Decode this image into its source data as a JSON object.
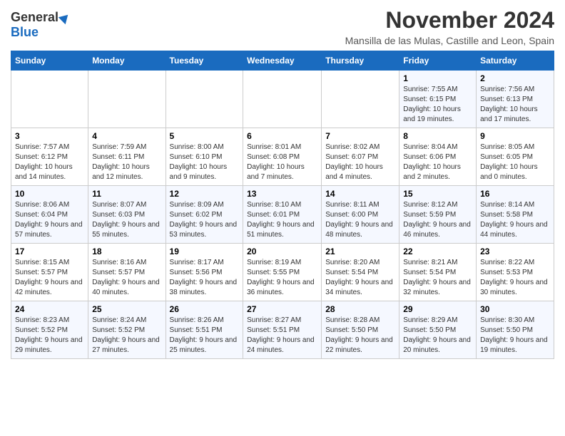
{
  "header": {
    "logo_general": "General",
    "logo_blue": "Blue",
    "month": "November 2024",
    "location": "Mansilla de las Mulas, Castille and Leon, Spain"
  },
  "weekdays": [
    "Sunday",
    "Monday",
    "Tuesday",
    "Wednesday",
    "Thursday",
    "Friday",
    "Saturday"
  ],
  "weeks": [
    [
      {
        "day": "",
        "info": ""
      },
      {
        "day": "",
        "info": ""
      },
      {
        "day": "",
        "info": ""
      },
      {
        "day": "",
        "info": ""
      },
      {
        "day": "",
        "info": ""
      },
      {
        "day": "1",
        "info": "Sunrise: 7:55 AM\nSunset: 6:15 PM\nDaylight: 10 hours and 19 minutes."
      },
      {
        "day": "2",
        "info": "Sunrise: 7:56 AM\nSunset: 6:13 PM\nDaylight: 10 hours and 17 minutes."
      }
    ],
    [
      {
        "day": "3",
        "info": "Sunrise: 7:57 AM\nSunset: 6:12 PM\nDaylight: 10 hours and 14 minutes."
      },
      {
        "day": "4",
        "info": "Sunrise: 7:59 AM\nSunset: 6:11 PM\nDaylight: 10 hours and 12 minutes."
      },
      {
        "day": "5",
        "info": "Sunrise: 8:00 AM\nSunset: 6:10 PM\nDaylight: 10 hours and 9 minutes."
      },
      {
        "day": "6",
        "info": "Sunrise: 8:01 AM\nSunset: 6:08 PM\nDaylight: 10 hours and 7 minutes."
      },
      {
        "day": "7",
        "info": "Sunrise: 8:02 AM\nSunset: 6:07 PM\nDaylight: 10 hours and 4 minutes."
      },
      {
        "day": "8",
        "info": "Sunrise: 8:04 AM\nSunset: 6:06 PM\nDaylight: 10 hours and 2 minutes."
      },
      {
        "day": "9",
        "info": "Sunrise: 8:05 AM\nSunset: 6:05 PM\nDaylight: 10 hours and 0 minutes."
      }
    ],
    [
      {
        "day": "10",
        "info": "Sunrise: 8:06 AM\nSunset: 6:04 PM\nDaylight: 9 hours and 57 minutes."
      },
      {
        "day": "11",
        "info": "Sunrise: 8:07 AM\nSunset: 6:03 PM\nDaylight: 9 hours and 55 minutes."
      },
      {
        "day": "12",
        "info": "Sunrise: 8:09 AM\nSunset: 6:02 PM\nDaylight: 9 hours and 53 minutes."
      },
      {
        "day": "13",
        "info": "Sunrise: 8:10 AM\nSunset: 6:01 PM\nDaylight: 9 hours and 51 minutes."
      },
      {
        "day": "14",
        "info": "Sunrise: 8:11 AM\nSunset: 6:00 PM\nDaylight: 9 hours and 48 minutes."
      },
      {
        "day": "15",
        "info": "Sunrise: 8:12 AM\nSunset: 5:59 PM\nDaylight: 9 hours and 46 minutes."
      },
      {
        "day": "16",
        "info": "Sunrise: 8:14 AM\nSunset: 5:58 PM\nDaylight: 9 hours and 44 minutes."
      }
    ],
    [
      {
        "day": "17",
        "info": "Sunrise: 8:15 AM\nSunset: 5:57 PM\nDaylight: 9 hours and 42 minutes."
      },
      {
        "day": "18",
        "info": "Sunrise: 8:16 AM\nSunset: 5:57 PM\nDaylight: 9 hours and 40 minutes."
      },
      {
        "day": "19",
        "info": "Sunrise: 8:17 AM\nSunset: 5:56 PM\nDaylight: 9 hours and 38 minutes."
      },
      {
        "day": "20",
        "info": "Sunrise: 8:19 AM\nSunset: 5:55 PM\nDaylight: 9 hours and 36 minutes."
      },
      {
        "day": "21",
        "info": "Sunrise: 8:20 AM\nSunset: 5:54 PM\nDaylight: 9 hours and 34 minutes."
      },
      {
        "day": "22",
        "info": "Sunrise: 8:21 AM\nSunset: 5:54 PM\nDaylight: 9 hours and 32 minutes."
      },
      {
        "day": "23",
        "info": "Sunrise: 8:22 AM\nSunset: 5:53 PM\nDaylight: 9 hours and 30 minutes."
      }
    ],
    [
      {
        "day": "24",
        "info": "Sunrise: 8:23 AM\nSunset: 5:52 PM\nDaylight: 9 hours and 29 minutes."
      },
      {
        "day": "25",
        "info": "Sunrise: 8:24 AM\nSunset: 5:52 PM\nDaylight: 9 hours and 27 minutes."
      },
      {
        "day": "26",
        "info": "Sunrise: 8:26 AM\nSunset: 5:51 PM\nDaylight: 9 hours and 25 minutes."
      },
      {
        "day": "27",
        "info": "Sunrise: 8:27 AM\nSunset: 5:51 PM\nDaylight: 9 hours and 24 minutes."
      },
      {
        "day": "28",
        "info": "Sunrise: 8:28 AM\nSunset: 5:50 PM\nDaylight: 9 hours and 22 minutes."
      },
      {
        "day": "29",
        "info": "Sunrise: 8:29 AM\nSunset: 5:50 PM\nDaylight: 9 hours and 20 minutes."
      },
      {
        "day": "30",
        "info": "Sunrise: 8:30 AM\nSunset: 5:50 PM\nDaylight: 9 hours and 19 minutes."
      }
    ]
  ]
}
